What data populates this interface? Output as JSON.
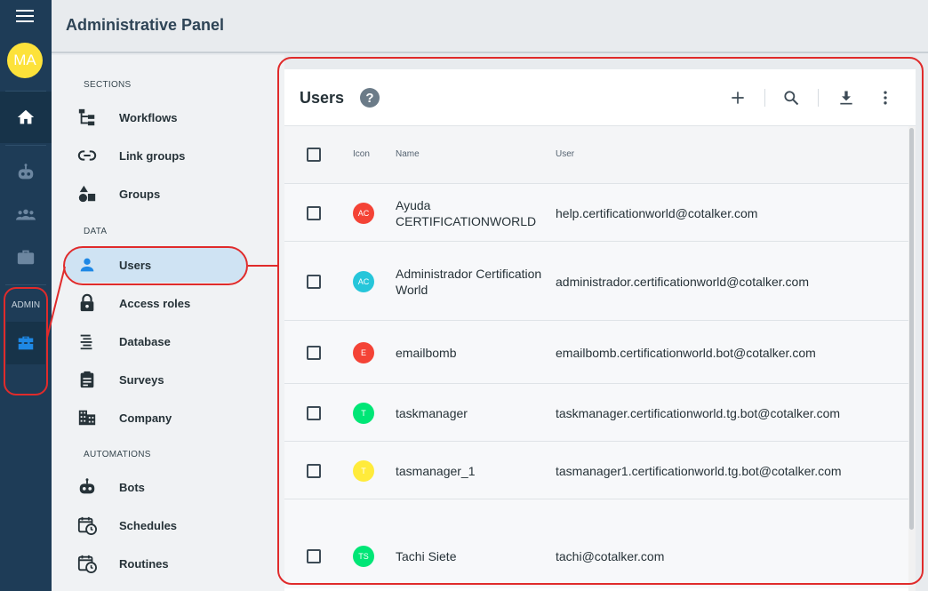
{
  "rail": {
    "avatar_initials": "MA",
    "admin_label": "ADMIN"
  },
  "header": {
    "title": "Administrative Panel"
  },
  "nav": {
    "sections_heading": "SECTIONS",
    "data_heading": "DATA",
    "automations_heading": "AUTOMATIONS",
    "items": [
      {
        "label": "Workflows",
        "icon": "workflow-tree-icon"
      },
      {
        "label": "Link groups",
        "icon": "link-icon"
      },
      {
        "label": "Groups",
        "icon": "shapes-icon"
      },
      {
        "label": "Users",
        "icon": "person-icon"
      },
      {
        "label": "Access roles",
        "icon": "lock-icon"
      },
      {
        "label": "Database",
        "icon": "list-lines-icon"
      },
      {
        "label": "Surveys",
        "icon": "clipboard-icon"
      },
      {
        "label": "Company",
        "icon": "building-icon"
      },
      {
        "label": "Bots",
        "icon": "robot-icon"
      },
      {
        "label": "Schedules",
        "icon": "calendar-clock-icon"
      },
      {
        "label": "Routines",
        "icon": "calendar-clock-icon"
      }
    ]
  },
  "main": {
    "title": "Users",
    "columns": {
      "icon": "Icon",
      "name": "Name",
      "user": "User"
    },
    "users": [
      {
        "initials": "AC",
        "name": "Ayuda CERTIFICATIONWORLD",
        "email": "help.certificationworld@cotalker.com",
        "color": "#f44336"
      },
      {
        "initials": "AC",
        "name": "Administrador Certification World",
        "email": "administrador.certificationworld@cotalker.com",
        "color": "#26c6da"
      },
      {
        "initials": "E",
        "name": "emailbomb",
        "email": "emailbomb.certificationworld.bot@cotalker.com",
        "color": "#f44336"
      },
      {
        "initials": "T",
        "name": "taskmanager",
        "email": "taskmanager.certificationworld.tg.bot@cotalker.com",
        "color": "#00e676"
      },
      {
        "initials": "T",
        "name": "tasmanager_1",
        "email": "tasmanager1.certificationworld.tg.bot@cotalker.com",
        "color": "#ffeb3b"
      },
      {
        "initials": "TS",
        "name": "Tachi Siete",
        "email": "tachi@cotalker.com",
        "color": "#00e676"
      }
    ]
  },
  "colors": {
    "rail": "#1e3c57",
    "accent_active": "#1e88e5",
    "annotation": "#e02b2b"
  }
}
